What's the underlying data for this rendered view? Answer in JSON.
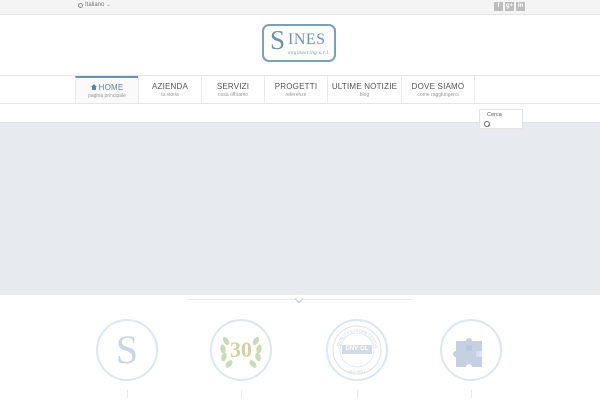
{
  "topbar": {
    "language": "Italiano",
    "social": [
      {
        "icon": "facebook-icon",
        "glyph": "f"
      },
      {
        "icon": "google-plus-icon",
        "glyph": "g+"
      },
      {
        "icon": "linkedin-icon",
        "glyph": "in"
      }
    ]
  },
  "logo": {
    "big_letter": "S",
    "rest": "INES",
    "tagline": "engineering s.r.l."
  },
  "nav": {
    "items": [
      {
        "label": "HOME",
        "sub": "pagina principale",
        "active": true
      },
      {
        "label": "AZIENDA",
        "sub": "la storia"
      },
      {
        "label": "SERVIZI",
        "sub": "cosa offriamo"
      },
      {
        "label": "PROGETTI",
        "sub": "referenze"
      },
      {
        "label": "ULTIME NOTIZIE",
        "sub": "blog"
      },
      {
        "label": "DOVE SIAMO",
        "sub": "come raggiungerci"
      }
    ]
  },
  "search": {
    "placeholder": "Cerca"
  },
  "features": {
    "logo_letter": "S",
    "anniversary": "30",
    "cert_ring": "QUALITY SYSTEM CERTIFICATION",
    "cert_badge": "DNV·GL",
    "cert_iso": "ISO 9001"
  },
  "colors": {
    "accent": "#6a93b1",
    "hero_bg": "#e7ebef"
  }
}
